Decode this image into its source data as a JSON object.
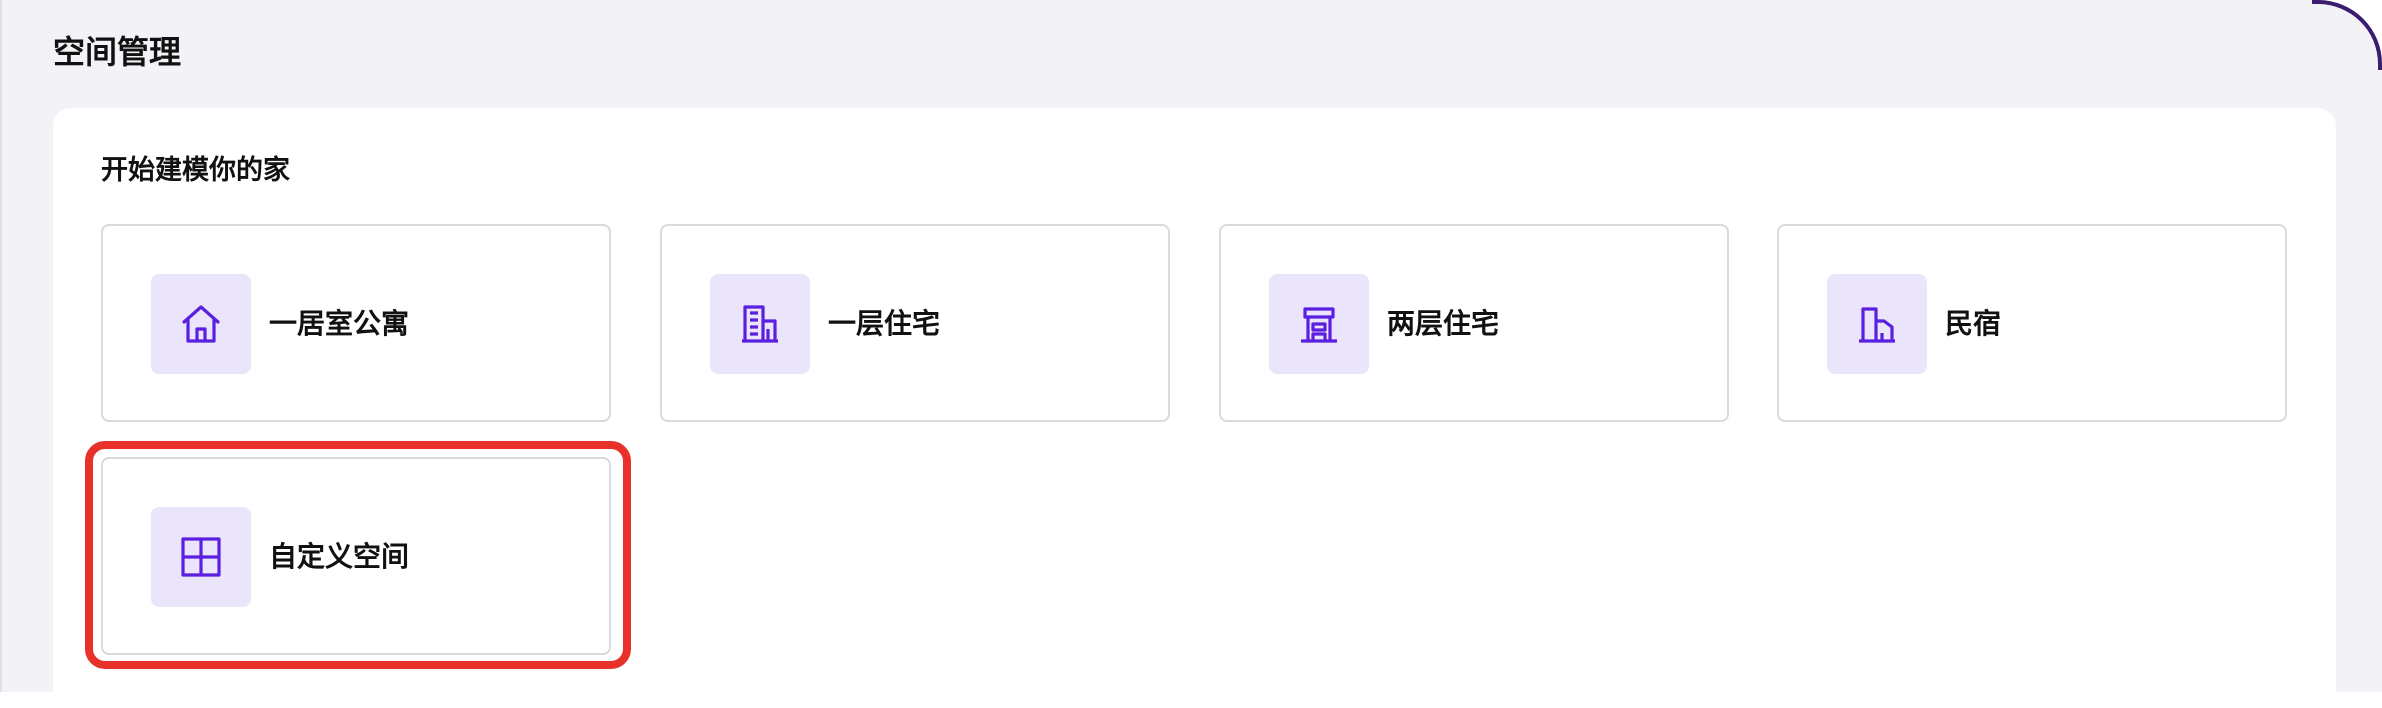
{
  "page": {
    "title": "空间管理"
  },
  "section": {
    "title": "开始建模你的家"
  },
  "cards": [
    {
      "label": "一居室公寓",
      "icon": "house-icon"
    },
    {
      "label": "一层住宅",
      "icon": "building-icon"
    },
    {
      "label": "两层住宅",
      "icon": "two-story-icon"
    },
    {
      "label": "民宿",
      "icon": "homestay-icon"
    },
    {
      "label": "自定义空间",
      "icon": "grid-icon"
    }
  ],
  "colors": {
    "icon_stroke": "#5b1fe0",
    "icon_bg": "#ebe5fb",
    "highlight": "#e8312b",
    "page_bg": "#f2f2f7"
  }
}
